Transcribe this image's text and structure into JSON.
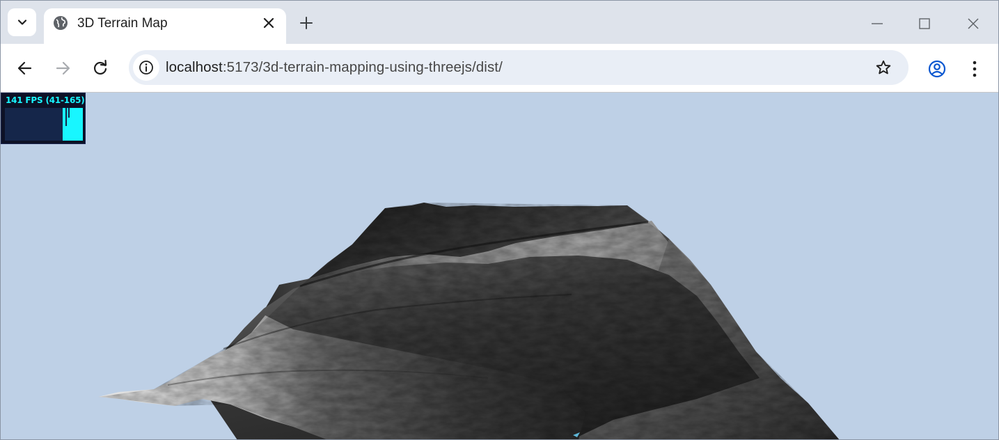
{
  "browser": {
    "tab": {
      "title": "3D Terrain Map"
    },
    "address_bar": {
      "host": "localhost",
      "path": ":5173/3d-terrain-mapping-using-threejs/dist/"
    },
    "icons": {
      "tab_search": "chevron-down-icon",
      "favicon": "globe-icon",
      "tab_close": "close-icon",
      "new_tab": "plus-icon",
      "minimize": "minimize-icon",
      "maximize": "maximize-icon",
      "window_close": "close-icon",
      "back": "arrow-left-icon",
      "forward": "arrow-right-icon",
      "reload": "reload-icon",
      "site_info": "info-icon",
      "bookmark": "star-icon",
      "profile": "account-icon",
      "menu": "more-vertical-icon"
    }
  },
  "stats": {
    "text": "141 FPS (41-165)",
    "fps": 141,
    "min": 41,
    "max": 165
  },
  "colors": {
    "sky": "#bed0e6",
    "stats_text": "#18f6ff",
    "stats_bg": "#0d1126",
    "profile_accent": "#0b57d0"
  }
}
